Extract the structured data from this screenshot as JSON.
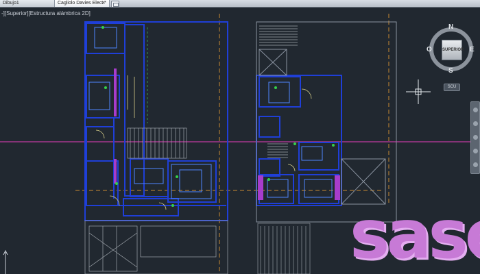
{
  "tabs": [
    {
      "label": "Dibujo1",
      "active": false
    },
    {
      "label": "Cagliolo Davies Elect.*",
      "active": true
    }
  ],
  "viewport": {
    "label": "-][Superior][Estructura alámbrica 2D]"
  },
  "viewcube": {
    "face": "SUPERIOR",
    "north": "N",
    "south": "S",
    "east": "E",
    "west": "O",
    "ucs": "SCU"
  },
  "logo": {
    "text": "sase"
  },
  "colors": {
    "background": "#212830",
    "walls": "#1f3fd8",
    "doors": "#d8d08a",
    "stairs": "#a0a6ad",
    "grid_axis": "#c03aa0",
    "dimension": "#c98a32",
    "logo": "#c77ad6"
  }
}
